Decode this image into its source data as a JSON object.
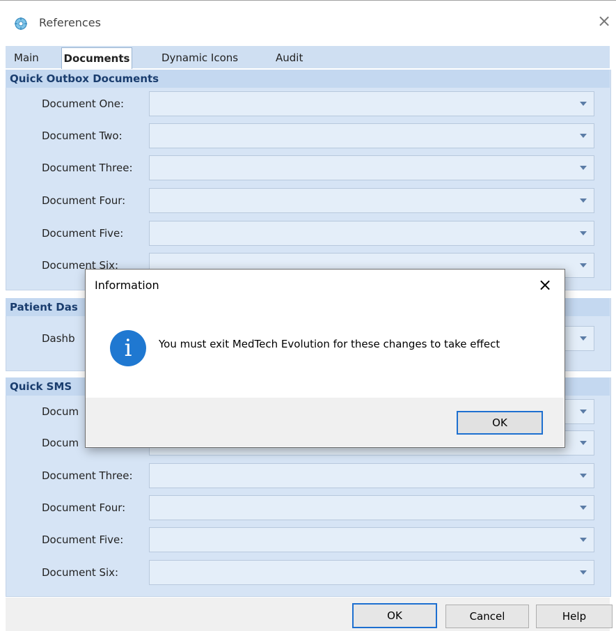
{
  "window": {
    "title": "References",
    "close_glyph": "×",
    "icon": "app-settings-icon"
  },
  "tabs": [
    {
      "label": "Main",
      "active": false
    },
    {
      "label": "Documents",
      "active": true
    },
    {
      "label": "Dynamic Icons",
      "active": false
    },
    {
      "label": "Audit",
      "active": false
    }
  ],
  "quick_outbox": {
    "title": "Quick Outbox Documents",
    "rows": [
      {
        "label": "Document One:",
        "value": ""
      },
      {
        "label": "Document Two:",
        "value": ""
      },
      {
        "label": "Document Three:",
        "value": ""
      },
      {
        "label": "Document Four:",
        "value": ""
      },
      {
        "label": "Document Five:",
        "value": ""
      },
      {
        "label": "Document Six:",
        "value": ""
      }
    ]
  },
  "patient_dashboard": {
    "title": "Patient Das",
    "rows": [
      {
        "label": "Dashb",
        "value": ""
      }
    ]
  },
  "quick_sms": {
    "title": "Quick SMS",
    "rows": [
      {
        "label": "Docum",
        "value": ""
      },
      {
        "label": "Docum",
        "value": ""
      },
      {
        "label": "Document Three:",
        "value": ""
      },
      {
        "label": "Document Four:",
        "value": ""
      },
      {
        "label": "Document Five:",
        "value": ""
      },
      {
        "label": "Document Six:",
        "value": ""
      }
    ]
  },
  "buttons": {
    "ok": "OK",
    "cancel": "Cancel",
    "help": "Help"
  },
  "dialog": {
    "title": "Information",
    "close_glyph": "×",
    "icon_glyph": "i",
    "message": "You must exit MedTech Evolution for these changes to take effect",
    "ok": "OK"
  },
  "colors": {
    "accent": "#1f78d1",
    "section_bg": "#d6e4f5",
    "combo_bg": "#e4eef9",
    "section_title": "#1a3d6e"
  }
}
